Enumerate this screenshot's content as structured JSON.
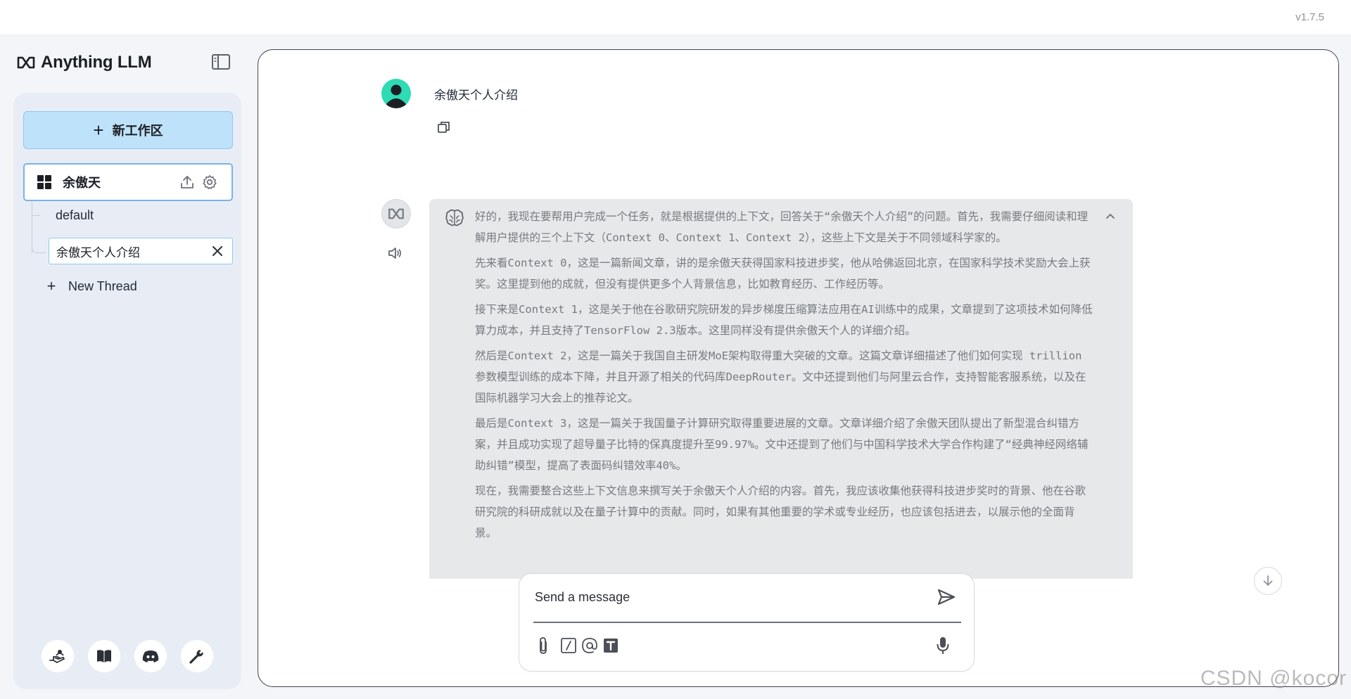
{
  "app": {
    "version": "v1.7.5",
    "brand": "Anything LLM"
  },
  "sidebar": {
    "new_workspace_label": "新工作区",
    "workspace": {
      "name": "余傲天",
      "threads": [
        {
          "name": "default",
          "active": false
        },
        {
          "name": "余傲天个人介绍",
          "active": true
        }
      ]
    },
    "new_thread_label": "New Thread",
    "footer_icons": [
      "community-hub-icon",
      "docs-book-icon",
      "discord-icon",
      "settings-wrench-icon"
    ]
  },
  "chat": {
    "user_message": "余傲天个人介绍",
    "thought_paragraphs": [
      "好的，我现在要帮用户完成一个任务，就是根据提供的上下文，回答关于“余傲天个人介绍”的问题。首先，我需要仔细阅读和理解用户提供的三个上下文（Context 0、Context 1、Context 2），这些上下文是关于不同领域科学家的。",
      "先来看Context 0，这是一篇新闻文章，讲的是余傲天获得国家科技进步奖，他从哈佛返回北京，在国家科学技术奖励大会上获奖。这里提到他的成就，但没有提供更多个人背景信息，比如教育经历、工作经历等。",
      "接下来是Context 1，这是关于他在谷歌研究院研发的异步梯度压缩算法应用在AI训练中的成果，文章提到了这项技术如何降低算力成本，并且支持了TensorFlow 2.3版本。这里同样没有提供余傲天个人的详细介绍。",
      "然后是Context 2，这是一篇关于我国自主研发MoE架构取得重大突破的文章。这篇文章详细描述了他们如何实现 trillion 参数模型训练的成本下降，并且开源了相关的代码库DeepRouter。文中还提到他们与阿里云合作，支持智能客服系统，以及在国际机器学习大会上的推荐论文。",
      "最后是Context 3，这是一篇关于我国量子计算研究取得重要进展的文章。文章详细介绍了余傲天团队提出了新型混合纠错方案，并且成功实现了超导量子比特的保真度提升至99.97%。文中还提到了他们与中国科学技术大学合作构建了“经典神经网络辅助纠错”模型，提高了表面码纠错效率40%。",
      "现在，我需要整合这些上下文信息来撰写关于余傲天个人介绍的内容。首先，我应该收集他获得科技进步奖时的背景、他在谷歌研究院的科研成就以及在量子计算中的贡献。同时，如果有其他重要的学术或专业经历，也应该包括进去，以展示他的全面背景。"
    ]
  },
  "composer": {
    "placeholder": "Send a message",
    "value": ""
  },
  "watermark": "CSDN @kocor",
  "colors": {
    "new_workspace_bg": "#bfe2fb",
    "active_border": "#76b4ea",
    "user_avatar": "#2ddbb4",
    "thought_bg": "#e7e8e9"
  }
}
